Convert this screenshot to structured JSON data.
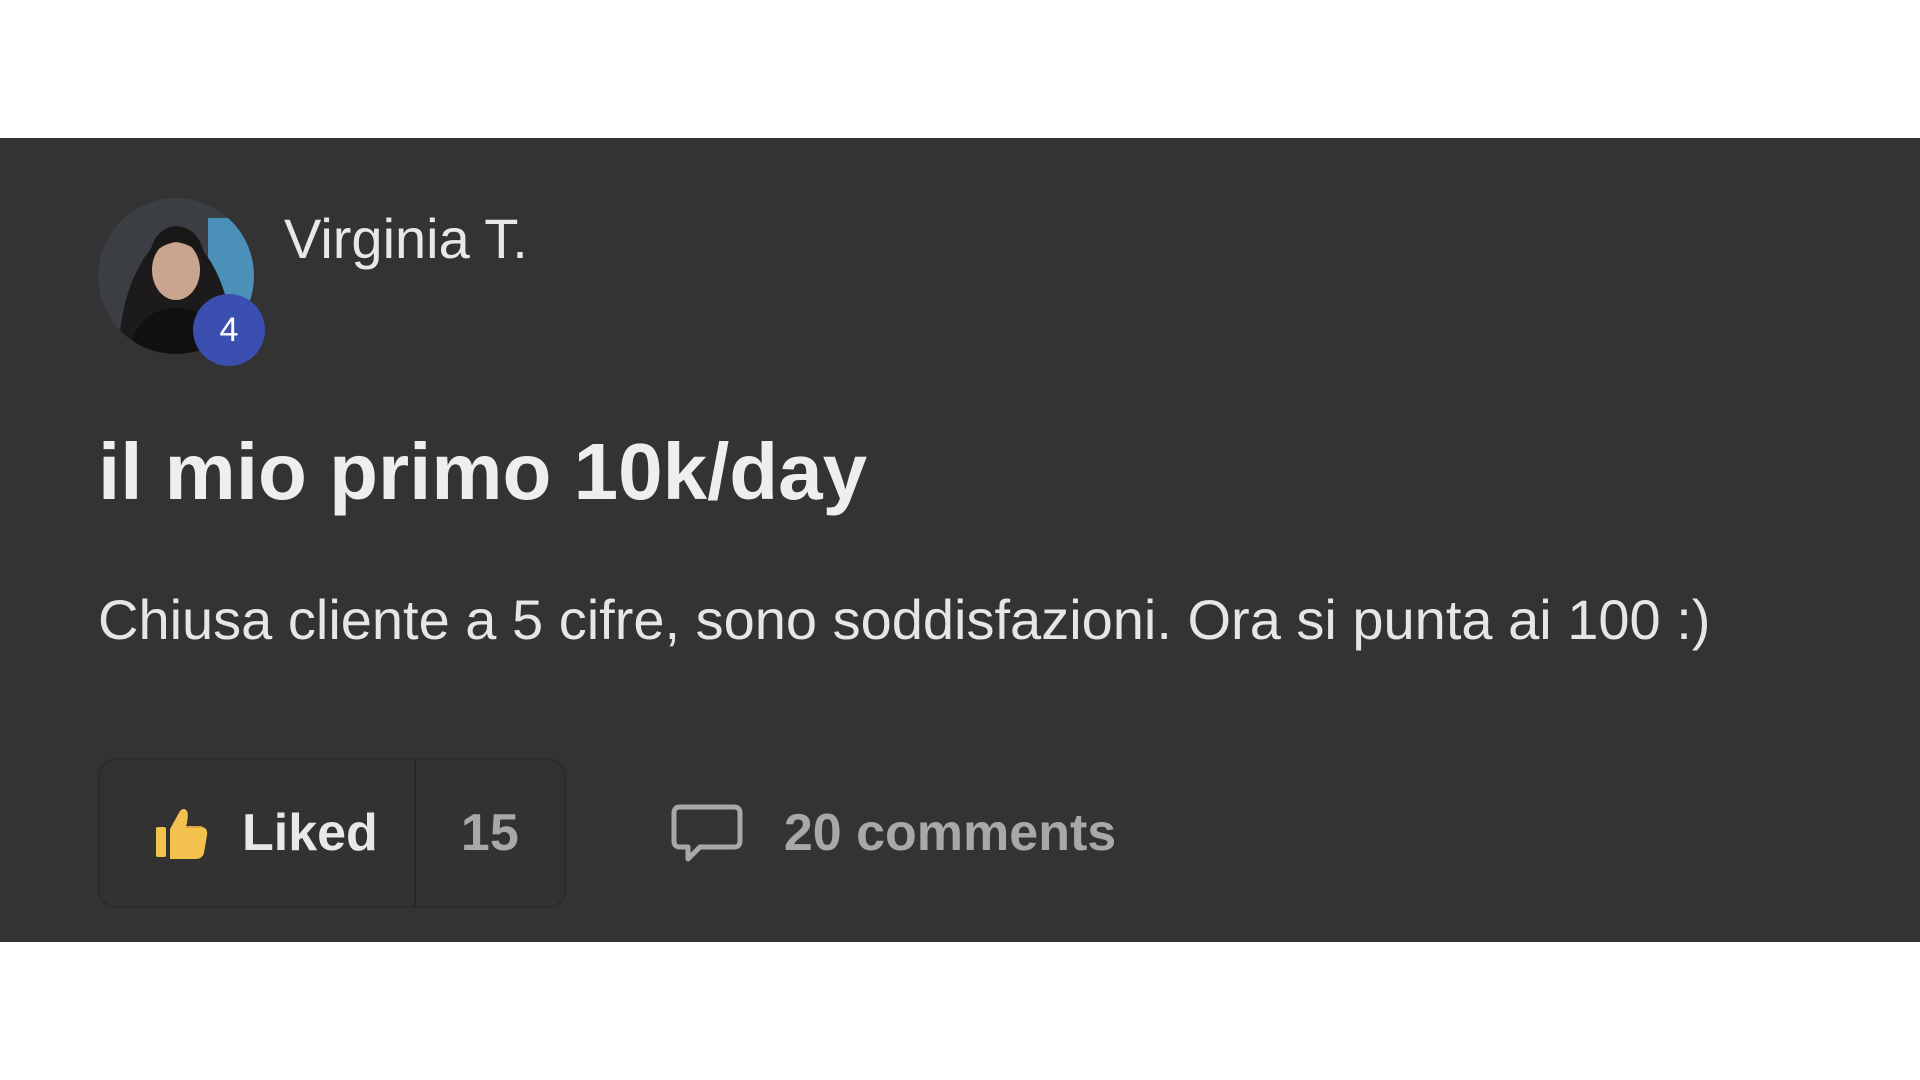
{
  "post": {
    "author": {
      "name": "Virginia T.",
      "level": "4",
      "avatar_icon": "user-avatar-photo"
    },
    "title": "il mio primo 10k/day",
    "body": "Chiusa cliente a 5 cifre, sono soddisfazioni. Ora si punta ai 100 :)",
    "actions": {
      "like_label": "Liked",
      "like_count": "15",
      "like_icon": "thumbs-up-icon",
      "comments_label": "20 comments",
      "comment_icon": "comment-bubble-icon"
    }
  },
  "colors": {
    "card_background": "#333333",
    "page_background": "#ffffff",
    "level_badge": "#3a4fb0",
    "like_icon": "#f2c14e",
    "muted_text": "#a8a8a8"
  }
}
